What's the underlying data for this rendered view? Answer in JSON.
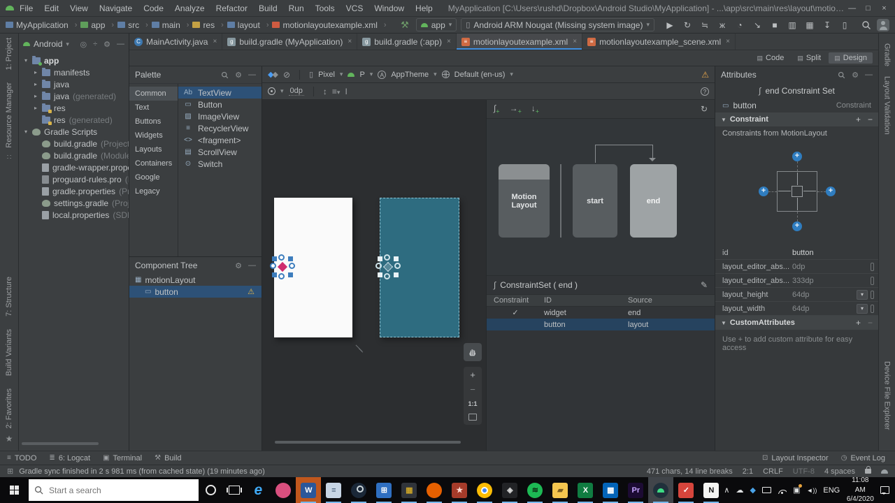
{
  "colors": {
    "selection_blue": "#2d5177",
    "accent_blue": "#3f8fe0",
    "android_green": "#62b45c",
    "run_green": "#59a869",
    "warning_orange": "#e5a54b",
    "blueprint_teal": "#2e6c80",
    "handle_pink": "#cf2d6e",
    "attention_orange": "#c0571d"
  },
  "titlebar": {
    "menus": [
      "File",
      "Edit",
      "View",
      "Navigate",
      "Code",
      "Analyze",
      "Refactor",
      "Build",
      "Run",
      "Tools",
      "VCS",
      "Window",
      "Help"
    ],
    "title": "MyApplication [C:\\Users\\rushd\\Dropbox\\Android Studio\\MyApplication] - ...\\app\\src\\main\\res\\layout\\motionlayoutexample.xml [app]",
    "minimize": "—",
    "maximize": "□",
    "close": "×"
  },
  "toolbar": {
    "breadcrumbs": [
      {
        "label": "MyApplication",
        "bg": "#5f7ea5"
      },
      {
        "label": "app",
        "bg": "#5f9e5b"
      },
      {
        "label": "src",
        "bg": "#5f7ea5"
      },
      {
        "label": "main",
        "bg": "#5f7ea5"
      },
      {
        "label": "res",
        "bg": "#c4a144"
      },
      {
        "label": "layout",
        "bg": "#5f7ea5"
      },
      {
        "label": "motionlayoutexample.xml",
        "bg": "#cf5b41"
      }
    ],
    "run_config": "app",
    "device_selector": "Android ARM Nougat (Missing system image)",
    "run_icons": [
      {
        "name": "run",
        "glyph": "▶",
        "color": "#59a869"
      },
      {
        "name": "apply-changes",
        "glyph": "↻",
        "color": "#7c8487"
      },
      {
        "name": "apply-code-changes",
        "glyph": "≒",
        "color": "#7c8487"
      },
      {
        "name": "debug",
        "glyph": "ж",
        "color": "#62b45c"
      },
      {
        "name": "profile",
        "glyph": "◔",
        "color": "#7c8487"
      },
      {
        "name": "attach-debugger",
        "glyph": "↘",
        "color": "#62b45c"
      },
      {
        "name": "stop",
        "glyph": "■",
        "color": "#6e7477"
      },
      {
        "name": "device-manager",
        "glyph": "▥",
        "color": "#7c8487"
      },
      {
        "name": "avd-manager",
        "glyph": "▦",
        "color": "#7c8487"
      },
      {
        "name": "sdk-manager",
        "glyph": "↧",
        "color": "#7c8487"
      },
      {
        "name": "device-file-explorer",
        "glyph": "▯",
        "color": "#7c8487"
      }
    ]
  },
  "editor_tabs": [
    {
      "label": "MainActivity.java",
      "glyph": "C",
      "bg": "#3c78b0",
      "circle": true
    },
    {
      "label": "build.gradle (MyApplication)",
      "glyph": "g",
      "bg": "#87989f"
    },
    {
      "label": "build.gradle (:app)",
      "glyph": "g",
      "bg": "#87989f"
    },
    {
      "label": "motionlayoutexample.xml",
      "glyph": "≡",
      "bg": "#cf6a43",
      "active": true
    },
    {
      "label": "motionlayoutexample_scene.xml",
      "glyph": "≡",
      "bg": "#cf6a43"
    }
  ],
  "view_modes": [
    {
      "label": "Code"
    },
    {
      "label": "Split"
    },
    {
      "label": "Design",
      "active": true
    }
  ],
  "left_strip": {
    "top": [
      "1: Project",
      "Resource Manager"
    ],
    "bottom": [
      "7: Structure",
      "Build Variants",
      "2: Favorites"
    ]
  },
  "right_strip": {
    "top": [
      "Gradle",
      "Layout Validation"
    ],
    "bottom": [
      "Device File Explorer"
    ]
  },
  "project_panel": {
    "view_selector": "Android",
    "tree": [
      {
        "label": "app",
        "bold": true,
        "arrow": "▾",
        "icon": "folder-app",
        "indent": 0
      },
      {
        "label": "manifests",
        "arrow": "▸",
        "icon": "folder",
        "indent": 1
      },
      {
        "label": "java",
        "arrow": "▸",
        "icon": "folder",
        "indent": 1
      },
      {
        "label": "java",
        "hint": "(generated)",
        "arrow": "▸",
        "icon": "folder-gen",
        "indent": 1
      },
      {
        "label": "res",
        "arrow": "▸",
        "icon": "folder-res",
        "indent": 1
      },
      {
        "label": "res",
        "hint": "(generated)",
        "arrow": "",
        "icon": "folder-res",
        "indent": 1
      },
      {
        "label": "Gradle Scripts",
        "arrow": "▾",
        "icon": "gradle",
        "indent": 0
      },
      {
        "label": "build.gradle",
        "hint": "(Project: MyApplication)",
        "arrow": "",
        "icon": "gradle",
        "indent": 1
      },
      {
        "label": "build.gradle",
        "hint": "(Module: app)",
        "arrow": "",
        "icon": "gradle",
        "indent": 1
      },
      {
        "label": "gradle-wrapper.properties",
        "hint": "",
        "arrow": "",
        "icon": "props",
        "indent": 1
      },
      {
        "label": "proguard-rules.pro",
        "hint": "(ProGuard Rules)",
        "arrow": "",
        "icon": "pro",
        "indent": 1
      },
      {
        "label": "gradle.properties",
        "hint": "(Project Properties)",
        "arrow": "",
        "icon": "props",
        "indent": 1
      },
      {
        "label": "settings.gradle",
        "hint": "(Project Settings)",
        "arrow": "",
        "icon": "gradle",
        "indent": 1
      },
      {
        "label": "local.properties",
        "hint": "(SDK Location)",
        "arrow": "",
        "icon": "props",
        "indent": 1
      }
    ]
  },
  "palette": {
    "title": "Palette",
    "categories": [
      {
        "label": "Common",
        "selected": true
      },
      {
        "label": "Text"
      },
      {
        "label": "Buttons"
      },
      {
        "label": "Widgets"
      },
      {
        "label": "Layouts"
      },
      {
        "label": "Containers"
      },
      {
        "label": "Google"
      },
      {
        "label": "Legacy"
      }
    ],
    "items": [
      {
        "label": "TextView",
        "glyph": "Ab",
        "selected": true
      },
      {
        "label": "Button",
        "glyph": "▭"
      },
      {
        "label": "ImageView",
        "glyph": "▨"
      },
      {
        "label": "RecyclerView",
        "glyph": "≡"
      },
      {
        "label": "<fragment>",
        "glyph": "<>"
      },
      {
        "label": "ScrollView",
        "glyph": "▤"
      },
      {
        "label": "Switch",
        "glyph": "⊙"
      }
    ]
  },
  "component_tree": {
    "title": "Component Tree",
    "items": [
      {
        "label": "motionLayout",
        "glyph": "▦",
        "indent": 0
      },
      {
        "label": "button",
        "glyph": "▭",
        "indent": 1,
        "selected": true,
        "warning": true
      }
    ]
  },
  "design_toolbar": {
    "device": "Pixel",
    "api": "P",
    "theme": "AppTheme",
    "locale": "Default (en-us)",
    "default_margin": "0dp"
  },
  "zoom_controls": {
    "scale_label": "1:1"
  },
  "motion_editor": {
    "cards": [
      {
        "label": "Motion Layout",
        "strip": true
      },
      {
        "label": "start"
      },
      {
        "label": "end",
        "selected": true
      }
    ],
    "constraint_set": {
      "title": "ConstraintSet ( end )",
      "columns": [
        "Constraint",
        "ID",
        "Source"
      ],
      "rows": [
        {
          "checked": true,
          "id": "widget",
          "source": "end"
        },
        {
          "checked": false,
          "id": "button",
          "source": "layout",
          "selected": true
        }
      ]
    }
  },
  "attributes": {
    "title": "Attributes",
    "context_label": "end Constraint Set",
    "component": {
      "name": "button",
      "type": "Constraint"
    },
    "sections": {
      "constraint": "Constraint",
      "custom": "CustomAttributes"
    },
    "note": "Constraints from MotionLayout",
    "properties": [
      {
        "name": "id",
        "value": "button"
      },
      {
        "name": "layout_editor_abs...",
        "value": "0dp",
        "dim": true,
        "flag": true
      },
      {
        "name": "layout_editor_abs...",
        "value": "333dp",
        "dim": true,
        "flag": true
      },
      {
        "name": "layout_height",
        "value": "64dp",
        "dim": true,
        "dropdown": true,
        "flag": true
      },
      {
        "name": "layout_width",
        "value": "64dp",
        "dim": true,
        "dropdown": true,
        "flag": true
      }
    ],
    "custom_hint": "Use + to add custom attribute for easy access"
  },
  "bottom_bar": {
    "left": [
      {
        "label": "TODO",
        "glyph": "≡"
      },
      {
        "label": "6: Logcat",
        "glyph": "≣"
      },
      {
        "label": "Terminal",
        "glyph": "▣"
      },
      {
        "label": "Build",
        "glyph": "⚒"
      }
    ],
    "right": [
      {
        "label": "Layout Inspector",
        "glyph": "⊡"
      },
      {
        "label": "Event Log",
        "glyph": "◷"
      }
    ]
  },
  "status_bar": {
    "message": "Gradle sync finished in 2 s 981 ms (from cached state) (19 minutes ago)",
    "items": [
      "471 chars, 14 line breaks",
      "2:1",
      "CRLF",
      "UTF-8",
      "4 spaces"
    ]
  },
  "taskbar": {
    "search_placeholder": "Start a search",
    "apps": [
      {
        "name": "edge",
        "glyph": "e",
        "fg": "#3fa9f5",
        "bg": "transparent"
      },
      {
        "name": "paint-3d",
        "glyph": "",
        "bg": "#d94f7e",
        "circle": true
      },
      {
        "name": "word",
        "glyph": "W",
        "fg": "#ffffff",
        "bg": "#2b579a",
        "attention": true,
        "running": true
      },
      {
        "name": "notepad",
        "glyph": "≡",
        "fg": "#3f5873",
        "bg": "#c7d5e4",
        "running": true
      },
      {
        "name": "steam",
        "glyph": "",
        "bg": "#1b2838",
        "circle": true,
        "running": true
      },
      {
        "name": "calculator",
        "glyph": "⊞",
        "fg": "#ffffff",
        "bg": "#2f6fc1",
        "running": true
      },
      {
        "name": "video-editor",
        "glyph": "▦",
        "fg": "#c9a227",
        "bg": "#30343a",
        "running": true
      },
      {
        "name": "firefox",
        "glyph": "",
        "bg": "#e66000",
        "circle": true,
        "running": true
      },
      {
        "name": "wunderlist",
        "glyph": "★",
        "fg": "#ffd9d2",
        "bg": "#a63b2a",
        "running": true
      },
      {
        "name": "chrome",
        "glyph": "",
        "bg": "#fbbc05",
        "circle": true,
        "running": true
      },
      {
        "name": "unity",
        "glyph": "◈",
        "fg": "#d6d6d6",
        "bg": "#222326",
        "running": true
      },
      {
        "name": "spotify",
        "glyph": "≋",
        "fg": "#0c2a12",
        "bg": "#1db954",
        "circle": true,
        "running": true
      },
      {
        "name": "file-explorer",
        "glyph": "▰",
        "fg": "#7a5c1e",
        "bg": "#f5c64f",
        "running": true
      },
      {
        "name": "excel",
        "glyph": "X",
        "fg": "#ffffff",
        "bg": "#107c41",
        "running": true
      },
      {
        "name": "calendar",
        "glyph": "▦",
        "fg": "#ffffff",
        "bg": "#0364b8",
        "running": true
      },
      {
        "name": "premiere",
        "glyph": "Pr",
        "fg": "#c5a3ff",
        "bg": "#1c0b33",
        "running": true
      },
      {
        "name": "android-studio",
        "glyph": "",
        "bg": "#20303b",
        "circle": true,
        "active": true,
        "running": true
      },
      {
        "name": "todoist",
        "glyph": "✓",
        "fg": "#ffffff",
        "bg": "#d6453c",
        "running": true
      },
      {
        "name": "notion",
        "glyph": "N",
        "fg": "#111111",
        "bg": "#f5f5f3",
        "running": true
      }
    ],
    "tray": {
      "language": "ENG",
      "time": "11:08 AM",
      "date": "6/4/2020"
    }
  }
}
